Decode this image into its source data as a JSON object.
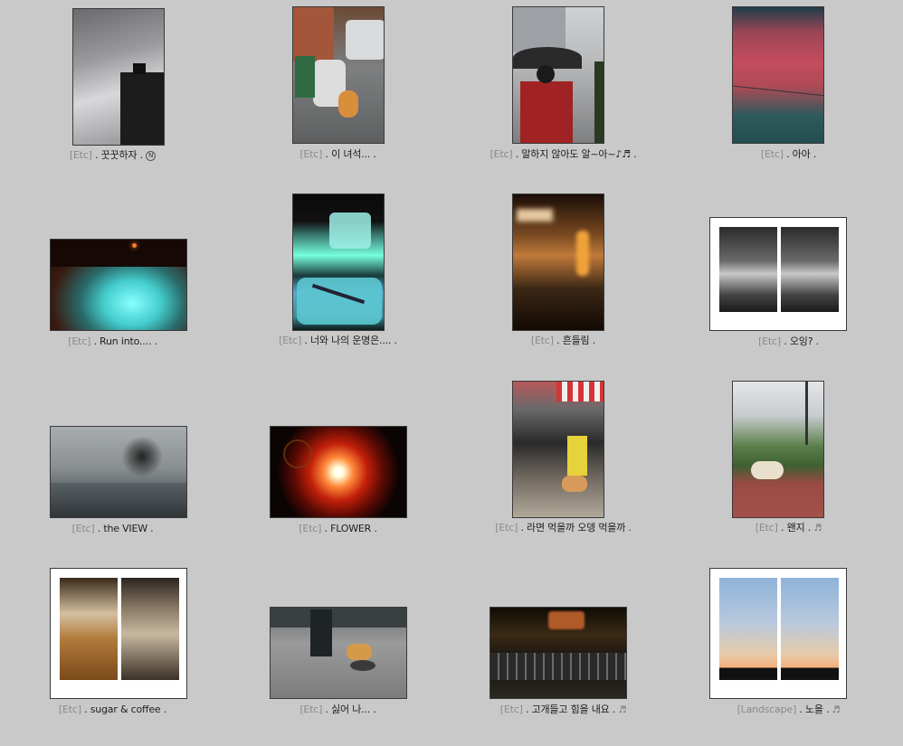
{
  "gallery": {
    "items": [
      {
        "category": "[Etc]",
        "title": ". 꿋꿋하자 .",
        "suffix": "N"
      },
      {
        "category": "[Etc]",
        "title": ". 이 녀석... .",
        "suffix": ""
      },
      {
        "category": "[Etc]",
        "title": ". 말하지 않아도 알~아~♪♬ .",
        "suffix": ""
      },
      {
        "category": "[Etc]",
        "title": ". 아아 .",
        "suffix": ""
      },
      {
        "category": "[Etc]",
        "title": ". Run into.... .",
        "suffix": ""
      },
      {
        "category": "[Etc]",
        "title": ". 너와 나의 운명은.... .",
        "suffix": ""
      },
      {
        "category": "[Etc]",
        "title": ". 흔들림 .",
        "suffix": ""
      },
      {
        "category": "[Etc]",
        "title": ". 오잉? .",
        "suffix": ""
      },
      {
        "category": "[Etc]",
        "title": ". the VIEW .",
        "suffix": ""
      },
      {
        "category": "[Etc]",
        "title": ". FLOWER .",
        "suffix": ""
      },
      {
        "category": "[Etc]",
        "title": ". 라면 먹을까 오뎅 먹을까 .",
        "suffix": ""
      },
      {
        "category": "[Etc]",
        "title": ". 왠지 .",
        "suffix": "♬"
      },
      {
        "category": "[Etc]",
        "title": ". sugar & coffee .",
        "suffix": ""
      },
      {
        "category": "[Etc]",
        "title": ". 싫어 나... .",
        "suffix": ""
      },
      {
        "category": "[Etc]",
        "title": ". 고개들고 힘을 내요 .",
        "suffix": "♬"
      },
      {
        "category": "[Landscape]",
        "title": ". 노을 .",
        "suffix": "♬"
      }
    ]
  },
  "photo_descriptions": {
    "icons": [
      "photo-thumbnail-icon"
    ]
  }
}
